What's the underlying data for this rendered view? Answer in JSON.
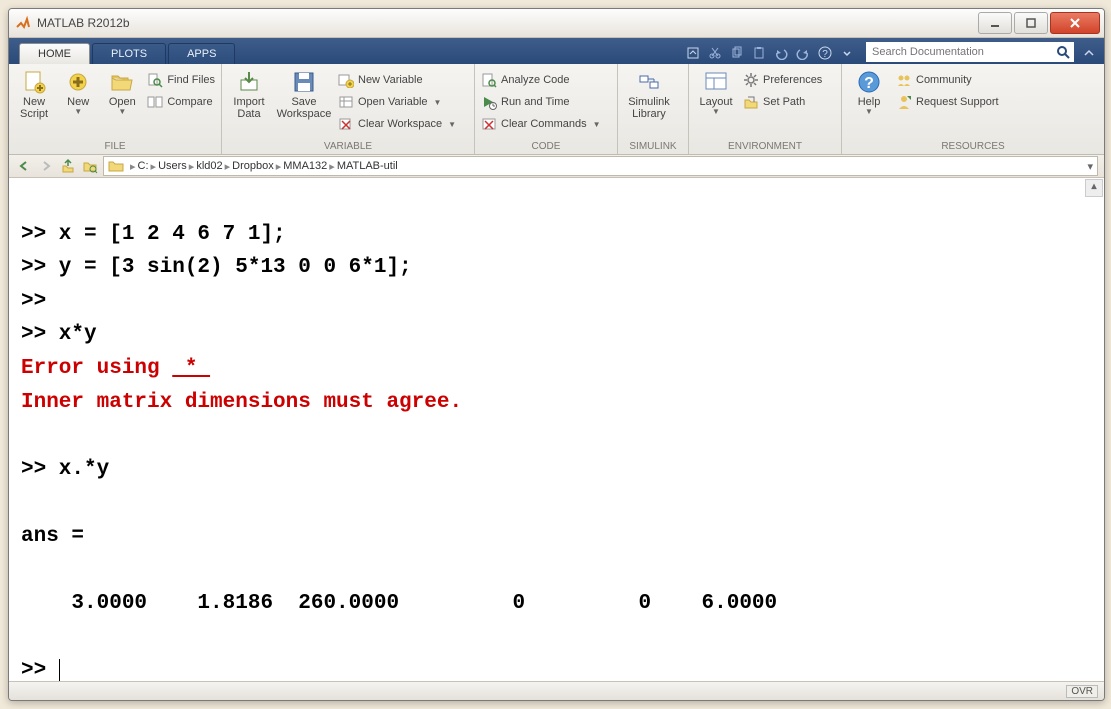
{
  "window": {
    "title": "MATLAB R2012b"
  },
  "tabs": {
    "home": "HOME",
    "plots": "PLOTS",
    "apps": "APPS"
  },
  "search": {
    "placeholder": "Search Documentation"
  },
  "ribbon": {
    "file": {
      "label": "FILE",
      "new_script": "New\nScript",
      "new": "New",
      "open": "Open",
      "find_files": "Find Files",
      "compare": "Compare"
    },
    "variable": {
      "label": "VARIABLE",
      "import": "Import\nData",
      "save_ws": "Save\nWorkspace",
      "new_var": "New Variable",
      "open_var": "Open Variable",
      "clear_ws": "Clear Workspace"
    },
    "code": {
      "label": "CODE",
      "analyze": "Analyze Code",
      "run_time": "Run and Time",
      "clear_cmd": "Clear Commands"
    },
    "simulink": {
      "label": "SIMULINK",
      "lib": "Simulink\nLibrary"
    },
    "environment": {
      "label": "ENVIRONMENT",
      "layout": "Layout",
      "prefs": "Preferences",
      "setpath": "Set Path"
    },
    "resources": {
      "label": "RESOURCES",
      "help": "Help",
      "community": "Community",
      "request": "Request Support"
    }
  },
  "breadcrumb": {
    "items": [
      "C:",
      "Users",
      "kld02",
      "Dropbox",
      "MMA132",
      "MATLAB-util"
    ]
  },
  "cmd": {
    "l1": ">> x = [1 2 4 6 7 1];",
    "l2": ">> y = [3 sin(2) 5*13 0 0 6*1];",
    "l3": ">> ",
    "l4": ">> x*y",
    "err1_a": "Error using ",
    "err_op": " * ",
    "err2": "Inner matrix dimensions must agree.",
    "l5": ">> x.*y",
    "l6": "ans =",
    "l7": "    3.0000    1.8186  260.0000         0         0    6.0000",
    "l8": ">> "
  },
  "status": {
    "ovr": "OVR"
  }
}
